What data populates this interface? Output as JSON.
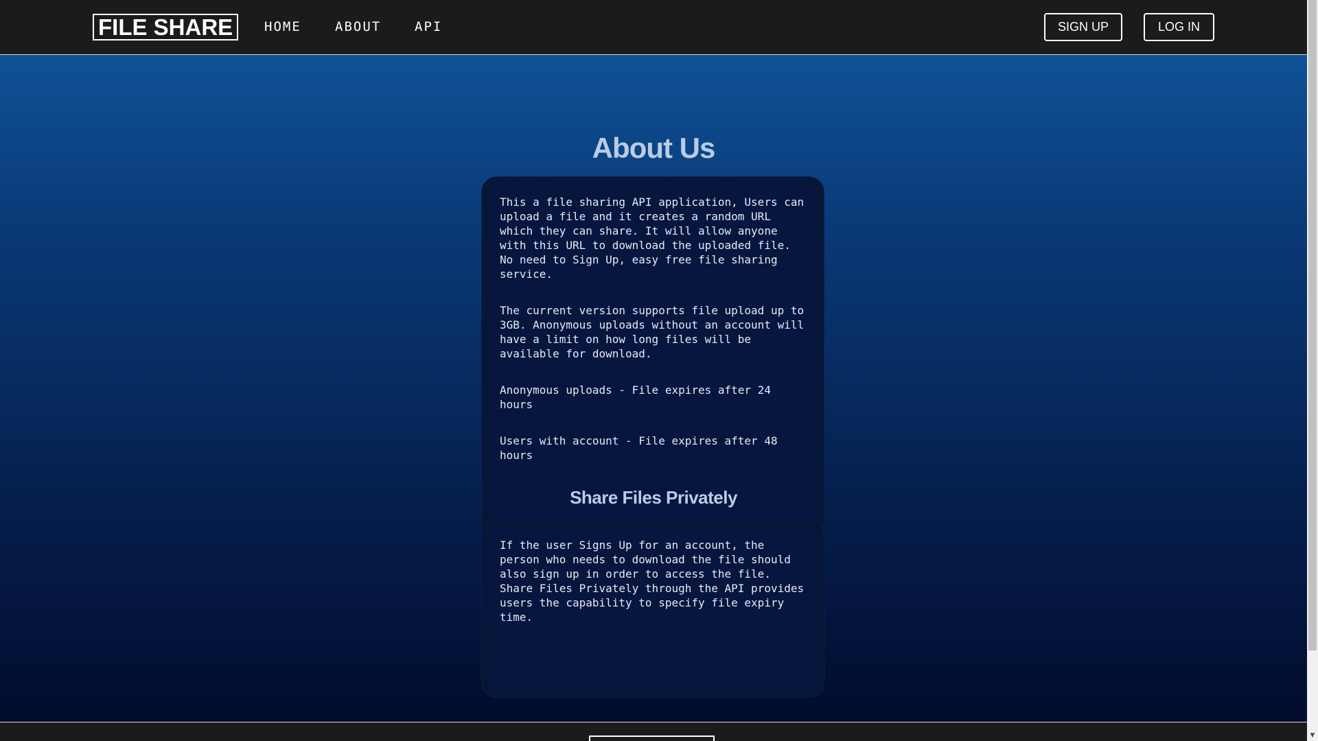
{
  "nav": {
    "brand": "FILE SHARE",
    "links": [
      "HOME",
      "ABOUT",
      "API"
    ],
    "signup_label": "SIGN UP",
    "login_label": "LOG IN"
  },
  "main": {
    "title": "About Us",
    "about_paragraphs": [
      "This a file sharing API application, Users can upload a file and it creates a random URL which they can share. It will allow anyone with this URL to download the uploaded file. No need to Sign Up, easy free file sharing service.",
      "The current version supports file upload up to 3GB. Anonymous uploads without an account will have a limit on how long files will be available for download.",
      "Anonymous uploads - File expires after 24 hours",
      "Users with account - File expires after 48 hours"
    ],
    "subtitle": "Share Files Privately",
    "private_paragraph": "If the user Signs Up for an account, the person who needs to download the file should also sign up in order to access the file. Share Files Privately through the API provides users the capability to specify file expiry time."
  },
  "icons": {
    "scroll_down": "chevron-down-icon"
  },
  "colors": {
    "navbar_bg": "#1b1b1b",
    "gradient_top": "#0f5296",
    "gradient_bottom": "#020c2e",
    "card_bg": "#06163f",
    "heading": "#b9cce6"
  }
}
